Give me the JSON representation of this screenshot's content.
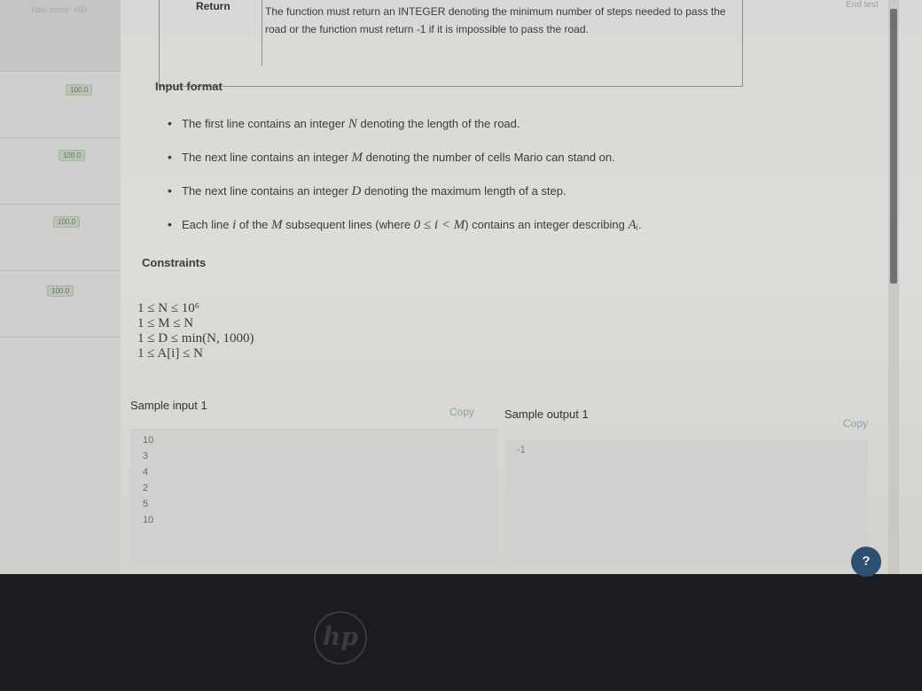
{
  "header": {
    "total_score": "Total score: 400",
    "end_test": "End test"
  },
  "sidebar": {
    "items": [
      {
        "score": "100.0"
      },
      {
        "score": "100.0"
      },
      {
        "score": "100.0"
      },
      {
        "score": "100.0"
      }
    ]
  },
  "returns": {
    "label": "Return",
    "text": "The function must return an INTEGER denoting the minimum number of steps needed to pass the road or the function must return -1 if it is impossible to pass the road."
  },
  "input_format": {
    "heading": "Input format",
    "bullets": [
      {
        "pre": "The first line contains an integer ",
        "var": "N",
        "post": " denoting the length of the road."
      },
      {
        "pre": "The next line contains an integer ",
        "var": "M",
        "post": " denoting the number of cells Mario can stand on."
      },
      {
        "pre": "The next line contains an integer ",
        "var": "D",
        "post": " denoting the maximum length of a step."
      },
      {
        "pre": "Each line ",
        "var": "i",
        "mid": " of the ",
        "var2": "M",
        "mid2": " subsequent lines (where ",
        "math": "0 ≤ i < M",
        "post": ") contains an integer describing ",
        "tail": "Aᵢ",
        "end": "."
      }
    ]
  },
  "constraints": {
    "heading": "Constraints",
    "lines": [
      "1 ≤ N ≤ 10⁶",
      "1 ≤ M ≤ N",
      "1 ≤ D ≤ min(N, 1000)",
      "1 ≤ A[i] ≤ N"
    ]
  },
  "sample_input": {
    "label": "Sample input 1",
    "copy": "Copy",
    "lines": [
      "10",
      "3",
      "4",
      "2",
      "5",
      "10"
    ]
  },
  "sample_output": {
    "label": "Sample output 1",
    "copy": "Copy",
    "lines": [
      "-1"
    ]
  },
  "help": {
    "icon": "?"
  },
  "laptop": {
    "brand": "hp"
  }
}
